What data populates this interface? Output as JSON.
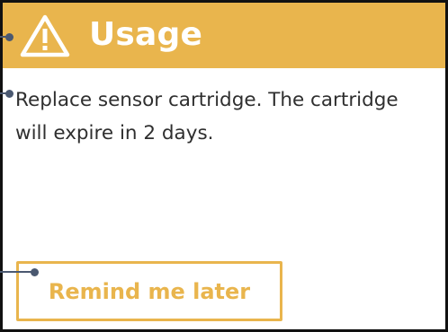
{
  "header": {
    "title": "Usage",
    "icon": "warning-triangle-icon",
    "background_color": "#e9b54d"
  },
  "message": {
    "text": "Replace sensor cartridge. The cartridge will expire in 2 days."
  },
  "actions": {
    "remind_label": "Remind me later",
    "accent_color": "#e9b54d"
  },
  "annotations": {
    "callout_color": "#4a5870"
  }
}
